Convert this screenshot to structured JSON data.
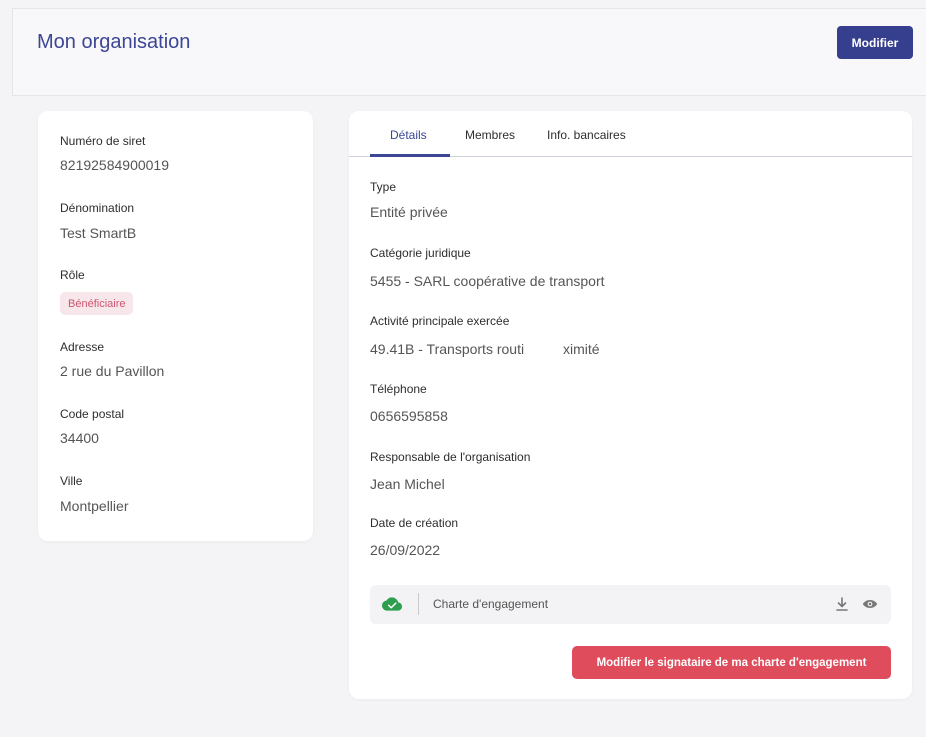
{
  "header": {
    "title": "Mon organisation",
    "edit_label": "Modifier"
  },
  "organisation": {
    "siret": {
      "label": "Numéro de siret",
      "value": "82192584900019"
    },
    "denomination": {
      "label": "Dénomination",
      "value": "Test SmartB"
    },
    "role": {
      "label": "Rôle",
      "value": "Bénéficiaire"
    },
    "address": {
      "label": "Adresse",
      "value": "2 rue du Pavillon"
    },
    "postal_code": {
      "label": "Code postal",
      "value": "34400"
    },
    "city": {
      "label": "Ville",
      "value": "Montpellier"
    }
  },
  "tabs": [
    {
      "label": "Détails",
      "active": true
    },
    {
      "label": "Membres",
      "active": false
    },
    {
      "label": "Info. bancaires",
      "active": false
    }
  ],
  "details": {
    "type": {
      "label": "Type",
      "value": "Entité privée"
    },
    "legal_category": {
      "label": "Catégorie juridique",
      "value": "5455 - SARL coopérative de transport"
    },
    "main_activity": {
      "label": "Activité principale exercée",
      "value": "49.41B - Transports routi          ximité"
    },
    "phone": {
      "label": "Téléphone",
      "value": "0656595858"
    },
    "manager": {
      "label": "Responsable de l'organisation",
      "value": "Jean Michel"
    },
    "creation_date": {
      "label": "Date de création",
      "value": "26/09/2022"
    }
  },
  "document": {
    "name": "Charte d'engagement",
    "status_icon": "cloud-check-icon",
    "status_color": "#2e9e4f"
  },
  "actions": {
    "change_signatory_label": "Modifier le signataire de ma charte d'engagement"
  },
  "colors": {
    "primary": "#363f8e",
    "danger": "#df4c5c",
    "badge_bg": "#f7e6ea",
    "badge_text": "#cc5770"
  }
}
